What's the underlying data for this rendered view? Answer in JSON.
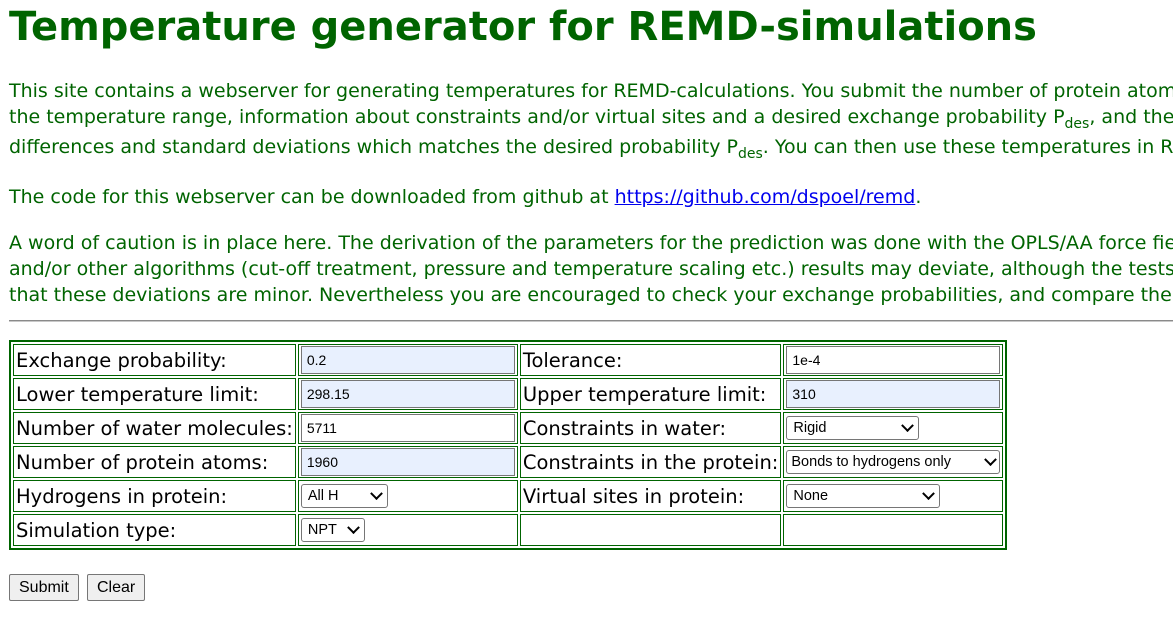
{
  "title": "Temperature generator for REMD-simulations",
  "intro": {
    "line1": "This site contains a webserver for generating temperatures for REMD-calculations. You submit the number of protein atoms and water molecules in your system,",
    "line2_a": "the temperature range, information about constraints and/or virtual sites and a desired exchange probability P",
    "line2_sub": "des",
    "line2_b": ", and the webserver calculates a set of temperatures with energy",
    "line3_a": "differences and standard deviations which matches the desired probability P",
    "line3_sub": "des",
    "line3_b": ". You can then use these temperatures in REMD-simulations."
  },
  "code": {
    "text_a": "The code for this webserver can be downloaded from github at ",
    "link": "https://github.com/dspoel/remd",
    "text_b": "."
  },
  "caution": {
    "line1": "A word of caution is in place here. The derivation of the parameters for the prediction was done with the OPLS/AA force field. If you use a different force field",
    "line2": "and/or other algorithms (cut-off treatment, pressure and temperature scaling etc.) results may deviate, although the tests we have done so far indicate",
    "line3": "that these deviations are minor. Nevertheless you are encouraged to check your exchange probabilities, and compare them with what was requested."
  },
  "form": {
    "exchange_probability": {
      "label": "Exchange probability:",
      "value": "0.2"
    },
    "tolerance": {
      "label": "Tolerance:",
      "value": "1e-4"
    },
    "lower_temp": {
      "label": "Lower temperature limit:",
      "value": "298.15"
    },
    "upper_temp": {
      "label": "Upper temperature limit:",
      "value": "310"
    },
    "water_molecules": {
      "label": "Number of water molecules:",
      "value": "5711"
    },
    "constraints_water": {
      "label": "Constraints in water:",
      "selected": "Rigid"
    },
    "protein_atoms": {
      "label": "Number of protein atoms:",
      "value": "1960"
    },
    "constraints_protein": {
      "label": "Constraints in the protein:",
      "selected": "Bonds to hydrogens only"
    },
    "hydrogens": {
      "label": "Hydrogens in protein:",
      "selected": "All H"
    },
    "virtual_sites": {
      "label": "Virtual sites in protein:",
      "selected": "None"
    },
    "simulation_type": {
      "label": "Simulation type:",
      "selected": "NPT"
    }
  },
  "buttons": {
    "submit": "Submit",
    "clear": "Clear"
  },
  "colors": {
    "text": "#006400",
    "link": "#0000ee",
    "autofill": "#e8f0fe",
    "table_border": "#006400"
  }
}
